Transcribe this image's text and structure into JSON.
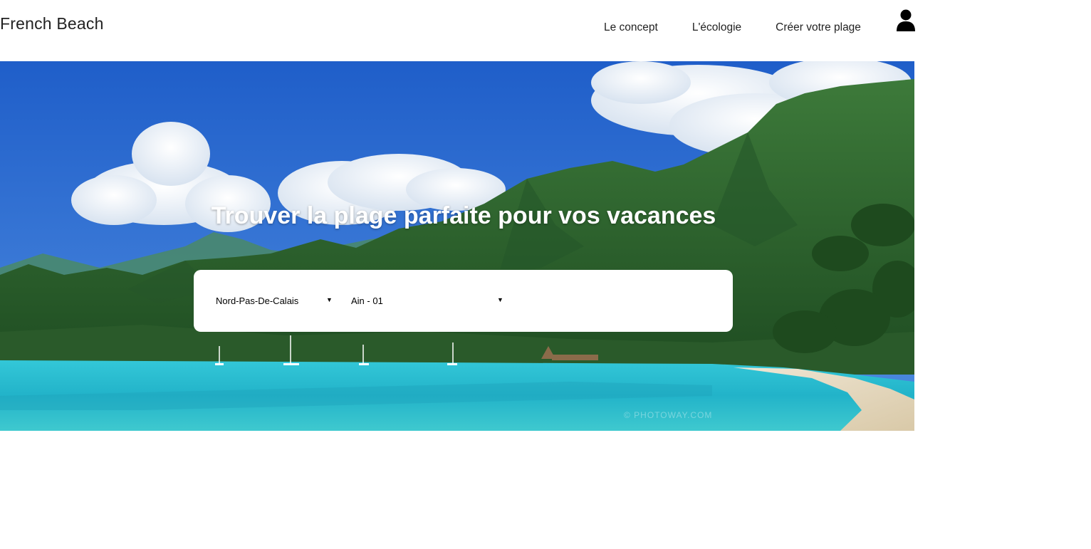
{
  "header": {
    "brand": "French Beach",
    "nav": [
      {
        "label": "Le concept"
      },
      {
        "label": "L'écologie"
      },
      {
        "label": "Créer votre plage"
      }
    ],
    "user_icon": "user-icon"
  },
  "hero": {
    "title": "Trouver la plage parfaite pour vos vacances",
    "search": {
      "region_value": "Nord-Pas-De-Calais",
      "department_value": "Ain - 01"
    },
    "watermark": "© PHOTOWAY.COM"
  },
  "colors": {
    "sky": "#2d6fd4",
    "sea": "#2ec4d6",
    "mountains": "#2f6a34",
    "text_dark": "#222222",
    "white": "#ffffff"
  }
}
